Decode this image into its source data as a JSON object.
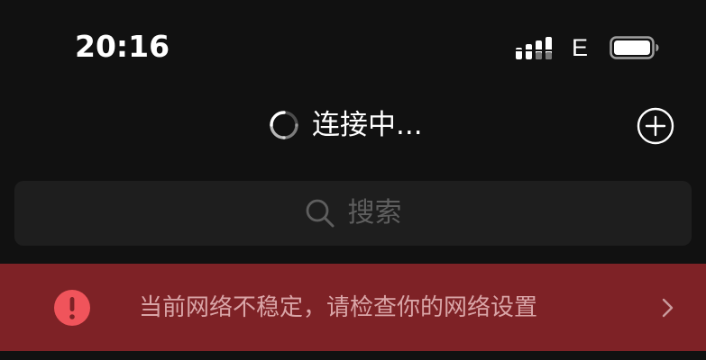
{
  "status_bar": {
    "time": "20:16",
    "network_type": "E",
    "signal_icon": "cellular-signal-icon",
    "battery_icon": "battery-icon"
  },
  "nav": {
    "title": "连接中...",
    "spinner_icon": "loading-spinner-icon",
    "add_icon": "plus-circle-icon"
  },
  "search": {
    "placeholder": "搜索",
    "icon": "search-icon"
  },
  "banner": {
    "text": "当前网络不稳定，请检查你的网络设置",
    "icon": "exclamation-circle-icon",
    "chevron_icon": "chevron-right-icon"
  },
  "colors": {
    "background": "#111111",
    "search_bg": "#1e1e1e",
    "banner_bg": "#7e2226",
    "banner_text": "#d9a5a7",
    "alert_red": "#f0545b",
    "placeholder": "#5e5e5e"
  }
}
